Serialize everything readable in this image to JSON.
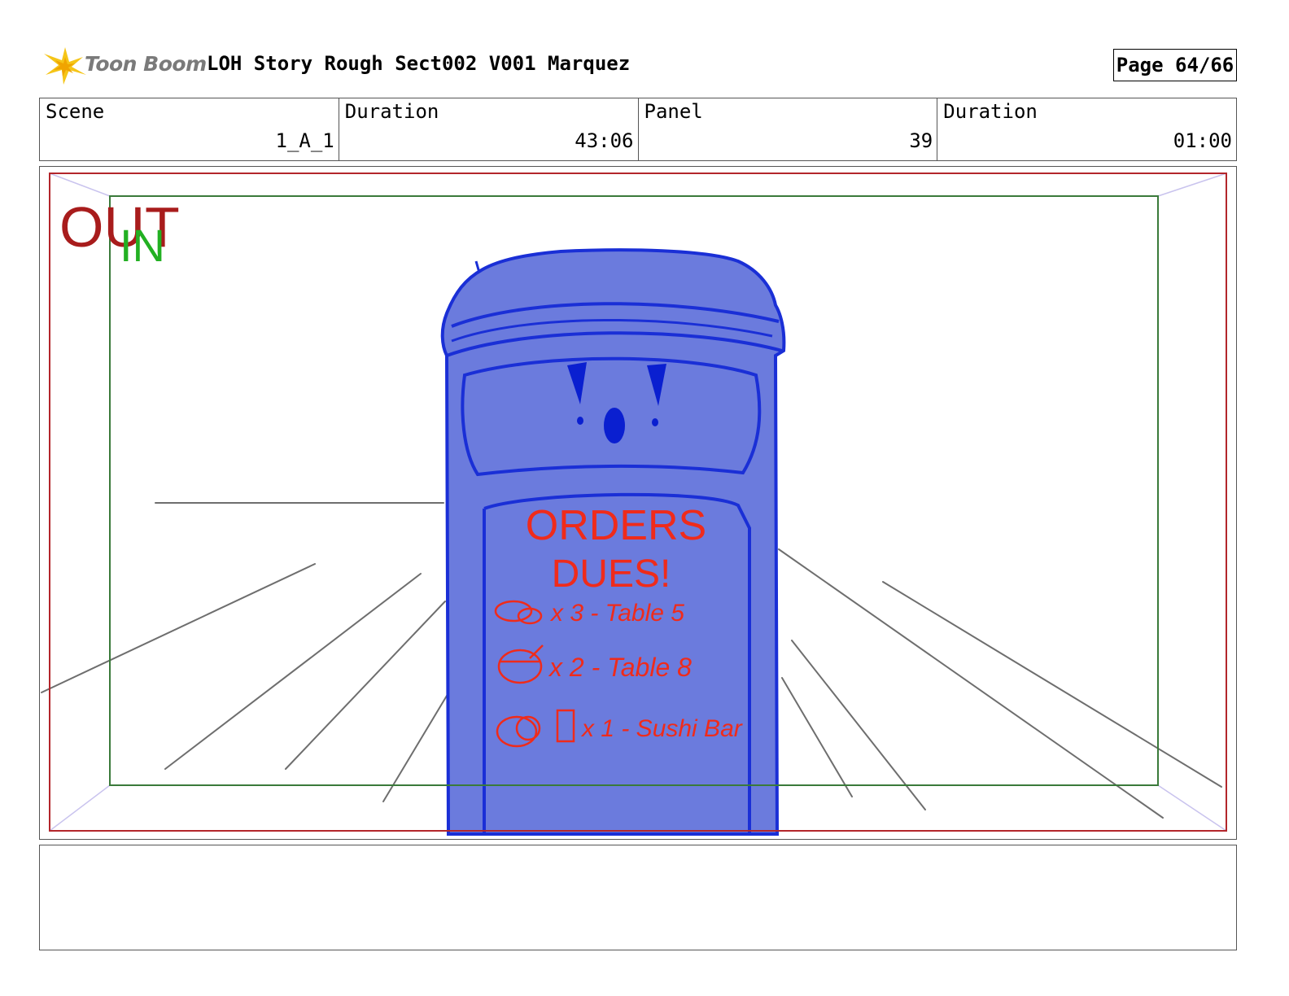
{
  "header": {
    "logo_text": "Toon Boom",
    "title": "LOH Story Rough Sect002 V001 Marquez",
    "page": "Page 64/66"
  },
  "info": {
    "scene_label": "Scene",
    "scene_value": "1_A_1",
    "scene_duration_label": "Duration",
    "scene_duration_value": "43:06",
    "panel_label": "Panel",
    "panel_value": "39",
    "panel_duration_label": "Duration",
    "panel_duration_value": "01:00"
  },
  "panel": {
    "out_label": "OUT",
    "in_label": "IN",
    "sign_line1": "ORDERS",
    "sign_line2": "DUES!",
    "order1": "x 3 - Table 5",
    "order2": "x 2 - Table 8",
    "order3": "x 1 - Sushi Bar",
    "colors": {
      "out_frame": "#b3262b",
      "in_frame": "#3a7a3a",
      "robot_fill": "#6b7bdd",
      "robot_outline": "#1a2fd6",
      "sign_text": "#ef2b1b",
      "perspective_lines": "#6e6e6e"
    }
  },
  "notes": {
    "text": ""
  }
}
